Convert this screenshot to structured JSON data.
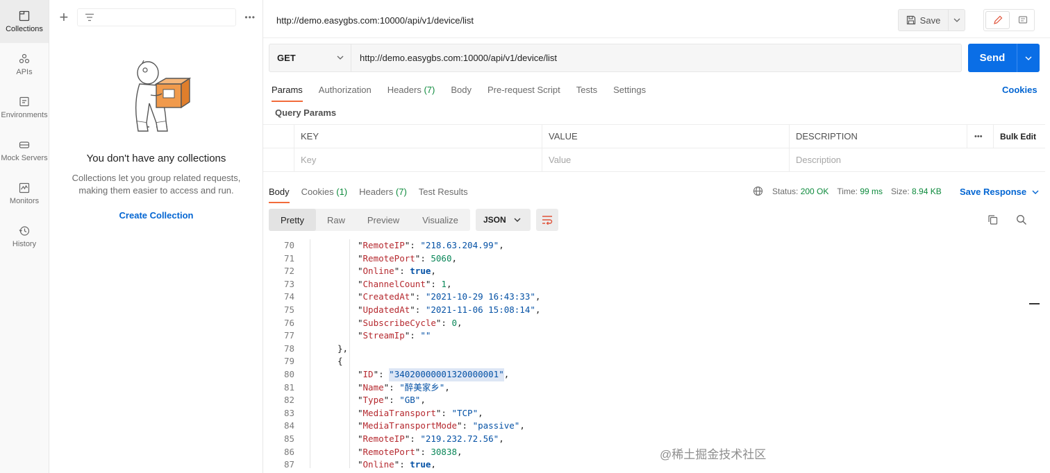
{
  "rail": {
    "items": [
      {
        "label": "Collections",
        "icon": "collections-icon"
      },
      {
        "label": "APIs",
        "icon": "apis-icon"
      },
      {
        "label": "Environments",
        "icon": "environments-icon"
      },
      {
        "label": "Mock Servers",
        "icon": "mock-servers-icon"
      },
      {
        "label": "Monitors",
        "icon": "monitors-icon"
      },
      {
        "label": "History",
        "icon": "history-icon"
      }
    ]
  },
  "panel": {
    "empty_title": "You don't have any collections",
    "empty_desc_line1": "Collections let you group related requests,",
    "empty_desc_line2": "making them easier to access and run.",
    "create_label": "Create Collection"
  },
  "header": {
    "title": "http://demo.easygbs.com:10000/api/v1/device/list",
    "save_label": "Save"
  },
  "request": {
    "method": "GET",
    "url": "http://demo.easygbs.com:10000/api/v1/device/list",
    "send_label": "Send",
    "tabs": [
      {
        "label": "Params",
        "count": ""
      },
      {
        "label": "Authorization",
        "count": ""
      },
      {
        "label": "Headers",
        "count": "(7)"
      },
      {
        "label": "Body",
        "count": ""
      },
      {
        "label": "Pre-request Script",
        "count": ""
      },
      {
        "label": "Tests",
        "count": ""
      },
      {
        "label": "Settings",
        "count": ""
      }
    ],
    "cookies_label": "Cookies",
    "query_params_label": "Query Params",
    "table": {
      "key_header": "KEY",
      "value_header": "VALUE",
      "desc_header": "DESCRIPTION",
      "bulk_edit": "Bulk Edit",
      "key_placeholder": "Key",
      "value_placeholder": "Value",
      "desc_placeholder": "Description"
    }
  },
  "response": {
    "tabs": [
      {
        "label": "Body",
        "count": ""
      },
      {
        "label": "Cookies",
        "count": "(1)"
      },
      {
        "label": "Headers",
        "count": "(7)"
      },
      {
        "label": "Test Results",
        "count": ""
      }
    ],
    "status_label": "Status:",
    "status_value": "200 OK",
    "time_label": "Time:",
    "time_value": "99 ms",
    "size_label": "Size:",
    "size_value": "8.94 KB",
    "save_response": "Save Response",
    "views": [
      "Pretty",
      "Raw",
      "Preview",
      "Visualize"
    ],
    "format": "JSON",
    "code_lines": [
      {
        "n": "70",
        "indent": 3,
        "key": "RemoteIP",
        "val": "\"218.63.204.99\"",
        "type": "s",
        "tail": ","
      },
      {
        "n": "71",
        "indent": 3,
        "key": "RemotePort",
        "val": "5060",
        "type": "n",
        "tail": ","
      },
      {
        "n": "72",
        "indent": 3,
        "key": "Online",
        "val": "true",
        "type": "b",
        "tail": ","
      },
      {
        "n": "73",
        "indent": 3,
        "key": "ChannelCount",
        "val": "1",
        "type": "n",
        "tail": ","
      },
      {
        "n": "74",
        "indent": 3,
        "key": "CreatedAt",
        "val": "\"2021-10-29 16:43:33\"",
        "type": "s",
        "tail": ","
      },
      {
        "n": "75",
        "indent": 3,
        "key": "UpdatedAt",
        "val": "\"2021-11-06 15:08:14\"",
        "type": "s",
        "tail": ","
      },
      {
        "n": "76",
        "indent": 3,
        "key": "SubscribeCycle",
        "val": "0",
        "type": "n",
        "tail": ","
      },
      {
        "n": "77",
        "indent": 3,
        "key": "StreamIp",
        "val": "\"\"",
        "type": "s",
        "tail": ""
      },
      {
        "n": "78",
        "indent": 2,
        "raw": "},"
      },
      {
        "n": "79",
        "indent": 2,
        "raw": "{"
      },
      {
        "n": "80",
        "indent": 3,
        "key": "ID",
        "val": "\"34020000001320000001\"",
        "type": "s",
        "tail": ",",
        "hl": true
      },
      {
        "n": "81",
        "indent": 3,
        "key": "Name",
        "val": "\"醉美家乡\"",
        "type": "s",
        "tail": ","
      },
      {
        "n": "82",
        "indent": 3,
        "key": "Type",
        "val": "\"GB\"",
        "type": "s",
        "tail": ","
      },
      {
        "n": "83",
        "indent": 3,
        "key": "MediaTransport",
        "val": "\"TCP\"",
        "type": "s",
        "tail": ","
      },
      {
        "n": "84",
        "indent": 3,
        "key": "MediaTransportMode",
        "val": "\"passive\"",
        "type": "s",
        "tail": ","
      },
      {
        "n": "85",
        "indent": 3,
        "key": "RemoteIP",
        "val": "\"219.232.72.56\"",
        "type": "s",
        "tail": ","
      },
      {
        "n": "86",
        "indent": 3,
        "key": "RemotePort",
        "val": "30838",
        "type": "n",
        "tail": ","
      },
      {
        "n": "87",
        "indent": 3,
        "key": "Online",
        "val": "true",
        "type": "b",
        "tail": ","
      }
    ]
  },
  "watermark": "@稀土掘金技术社区",
  "colors": {
    "accent": "#0a6ee6",
    "tab_underline": "#f26b3a",
    "success": "#0d8a3c"
  }
}
